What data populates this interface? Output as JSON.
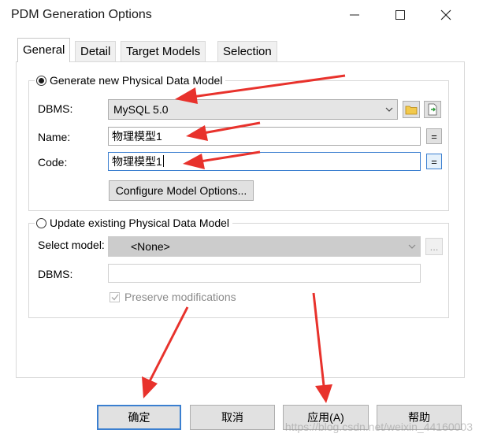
{
  "window": {
    "title": "PDM Generation Options",
    "controls": [
      "minimize-icon",
      "maximize-icon",
      "close-icon"
    ]
  },
  "tabs": [
    {
      "label": "General",
      "active": true
    },
    {
      "label": "Detail",
      "active": false
    },
    {
      "label": "Target Models",
      "active": false
    },
    {
      "label": "Selection",
      "active": false
    }
  ],
  "generate": {
    "option_label": "Generate new Physical Data Model",
    "selected": true,
    "dbms_label": "DBMS:",
    "dbms_value": "MySQL 5.0",
    "name_label": "Name:",
    "name_value": "物理模型1",
    "code_label": "Code:",
    "code_value": "物理模型1",
    "equals_symbol": "=",
    "configure_button": "Configure Model Options..."
  },
  "update": {
    "option_label": "Update existing Physical Data Model",
    "selected": false,
    "select_model_label": "Select model:",
    "select_model_value": "<None>",
    "browse_symbol": "...",
    "dbms_label": "DBMS:",
    "dbms_value": "",
    "preserve_label": "Preserve modifications",
    "preserve_checked": true
  },
  "buttons": {
    "ok": "确定",
    "cancel": "取消",
    "apply": "应用(A)",
    "help": "帮助"
  },
  "watermark": "https://blog.csdn.net/weixin_44160003",
  "colors": {
    "annotation_arrow": "#e8322c",
    "focus_blue": "#3b7fd0",
    "disabled_combo": "#cccccc"
  }
}
